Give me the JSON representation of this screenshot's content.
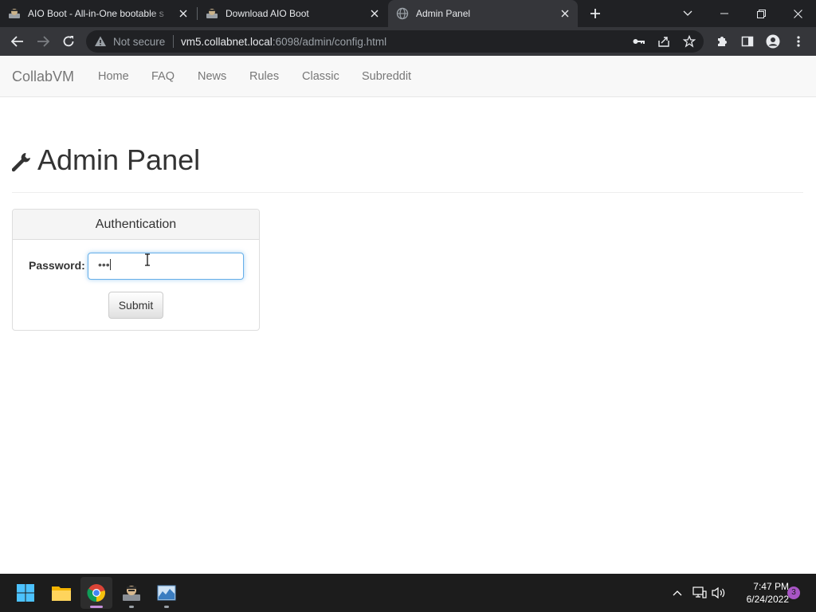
{
  "browser": {
    "tabs": [
      {
        "title": "AIO Boot - All-in-One bootable s"
      },
      {
        "title": "Download AIO Boot"
      },
      {
        "title": "Admin Panel"
      }
    ],
    "omnibox": {
      "security_label": "Not secure",
      "url_host": "vm5.collabnet.local",
      "url_rest": ":6098/admin/config.html"
    }
  },
  "navbar": {
    "brand": "CollabVM",
    "links": [
      "Home",
      "FAQ",
      "News",
      "Rules",
      "Classic",
      "Subreddit"
    ]
  },
  "page": {
    "title": "Admin Panel",
    "panel": {
      "heading": "Authentication",
      "password_label": "Password:",
      "password_value": "•••",
      "submit_label": "Submit"
    }
  },
  "taskbar": {
    "time": "7:47 PM",
    "date": "6/24/2022",
    "notification_count": "3"
  },
  "colors": {
    "chrome_frame": "#202124",
    "chrome_toolbar": "#35363a",
    "navbar_bg": "#f8f8f8",
    "input_focus": "#66afe9",
    "taskbar_bg": "#1c1c1c"
  }
}
